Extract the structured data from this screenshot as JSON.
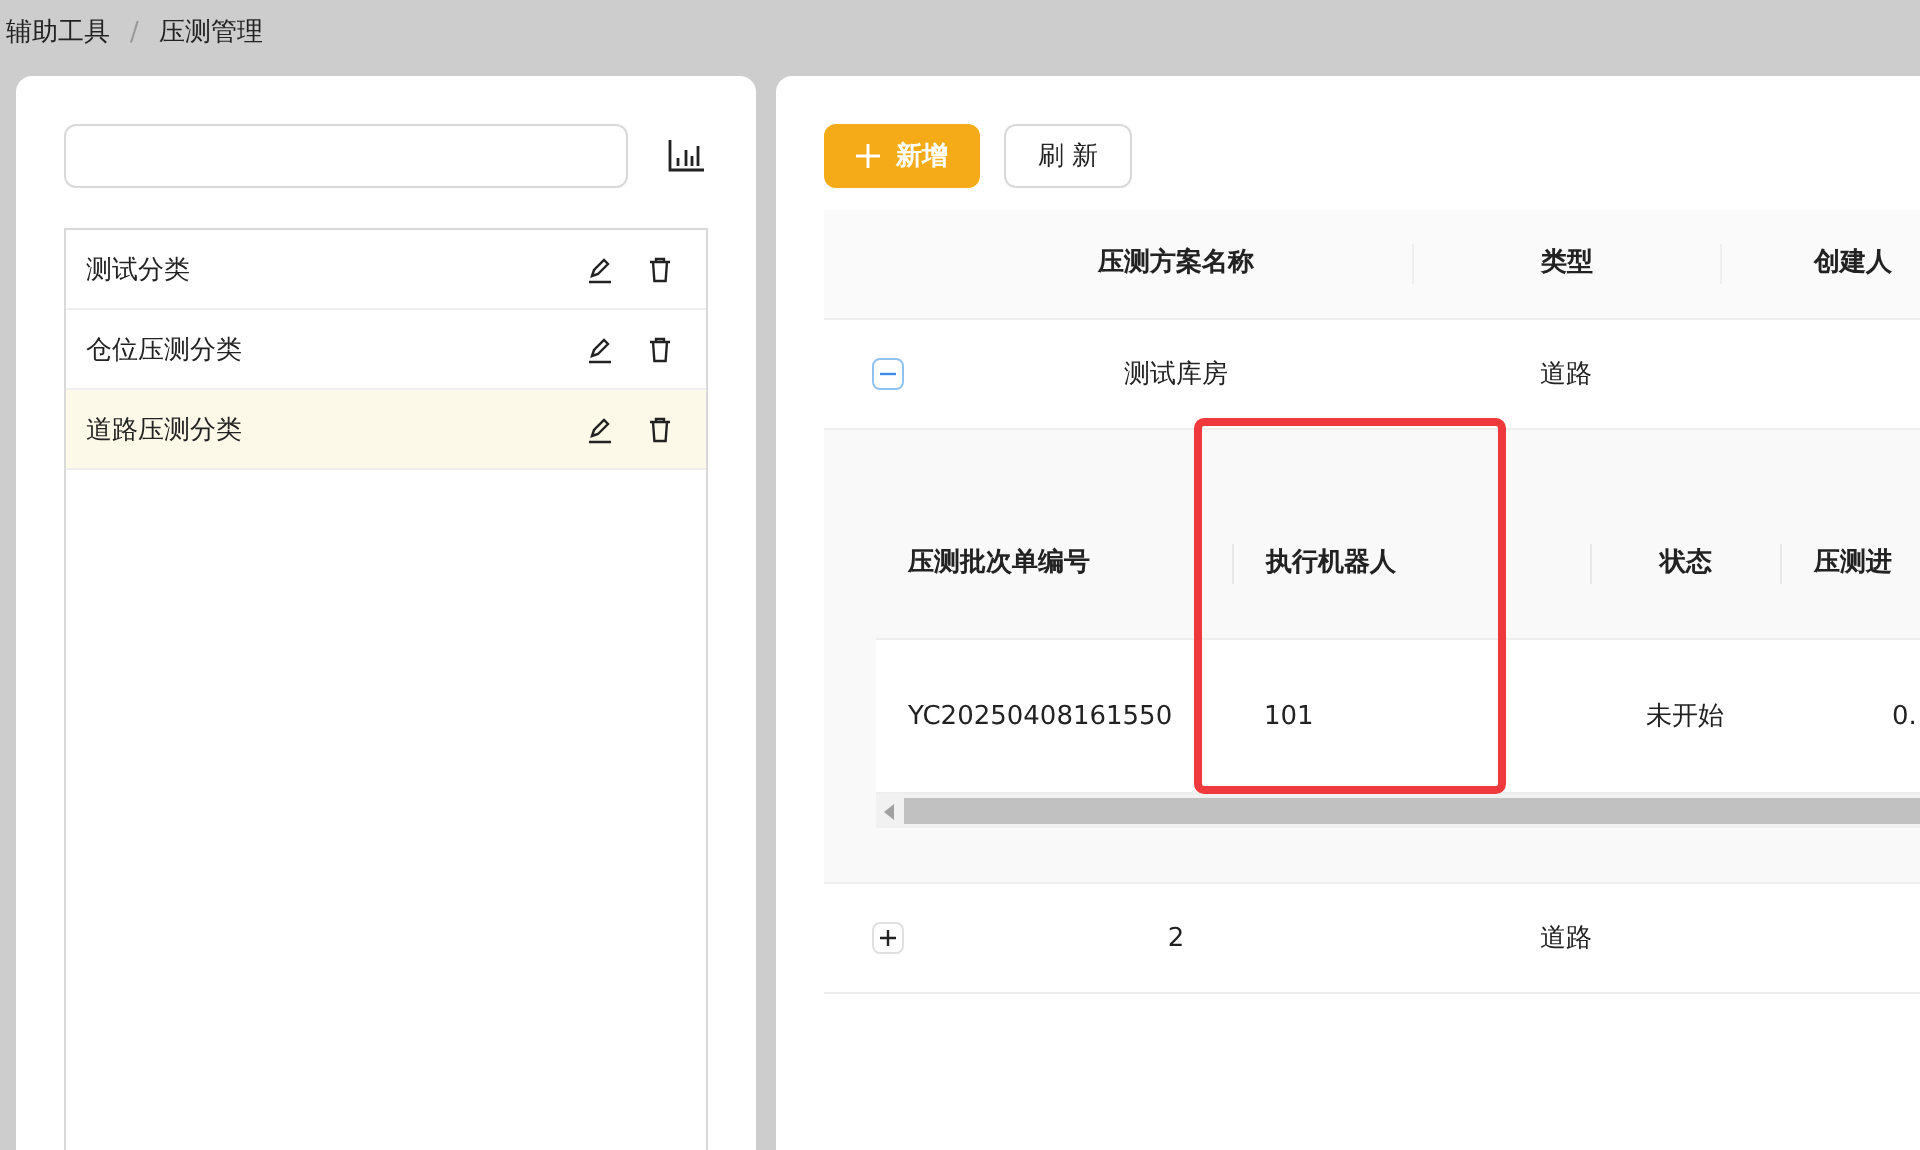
{
  "breadcrumb": [
    "辅助工具",
    "压测管理"
  ],
  "breadcrumb_separator": "/",
  "categories": [
    {
      "label": "测试分类",
      "selected": false
    },
    {
      "label": "仓位压测分类",
      "selected": false
    },
    {
      "label": "道路压测分类",
      "selected": true
    }
  ],
  "buttons": [
    {
      "kind": "primary",
      "label": "新增"
    },
    {
      "kind": "default",
      "label": "刷 新"
    }
  ],
  "table": {
    "columns": [
      "压测方案名称",
      "类型",
      "创建人"
    ],
    "rows": [
      {
        "expanded": true,
        "cells": [
          "测试库房",
          "道路",
          ""
        ],
        "batches": {
          "columns": [
            "压测批次单编号",
            "执行机器人",
            "状态",
            "压测进"
          ],
          "rows": [
            [
              "YC20250408161550",
              "101",
              "未开始",
              "0."
            ]
          ]
        }
      },
      {
        "expanded": false,
        "cells": [
          "2",
          "道路",
          ""
        ]
      }
    ]
  }
}
